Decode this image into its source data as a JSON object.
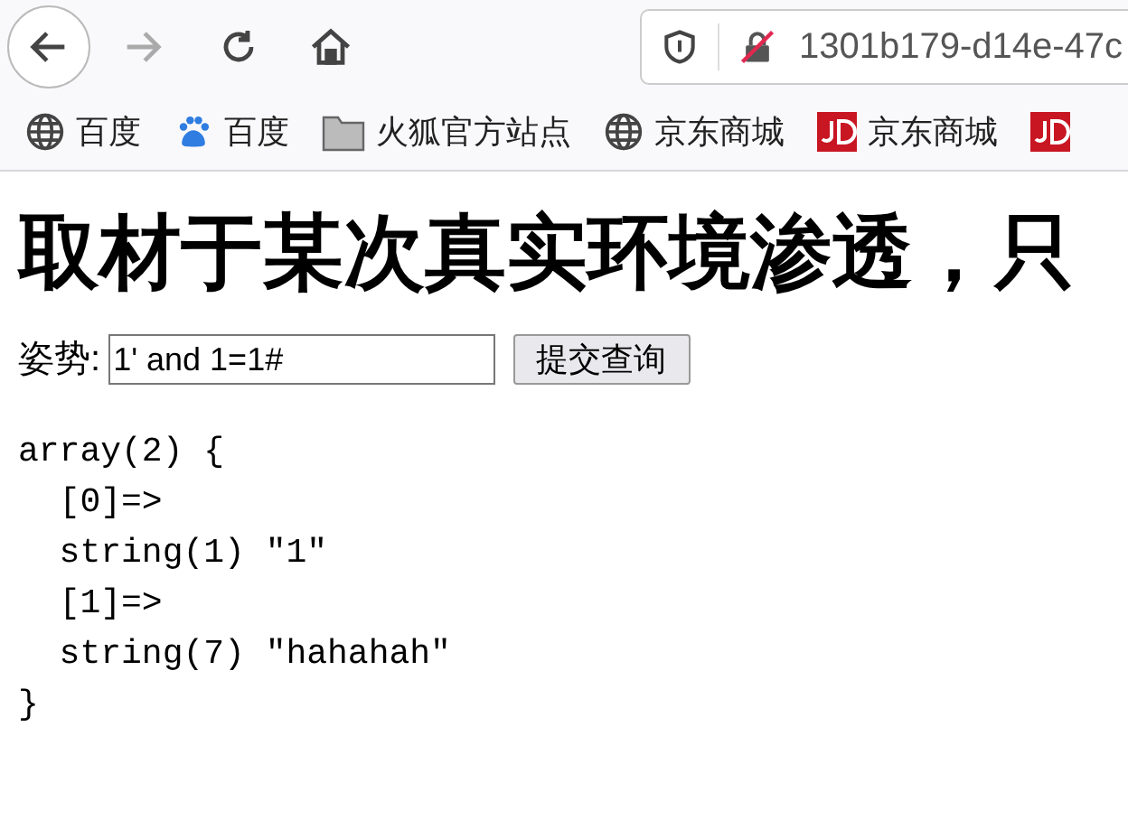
{
  "toolbar": {
    "url": "1301b179-d14e-47c"
  },
  "bookmarks": [
    {
      "kind": "globe",
      "label": "百度"
    },
    {
      "kind": "paw",
      "label": "百度"
    },
    {
      "kind": "folder",
      "label": "火狐官方站点"
    },
    {
      "kind": "globe",
      "label": "京东商城"
    },
    {
      "kind": "jd",
      "label": "京东商城"
    },
    {
      "kind": "jd"
    }
  ],
  "page": {
    "heading": "取材于某次真实环境渗透，只",
    "form": {
      "label": "姿势:",
      "value": "1' and 1=1#",
      "button": "提交查询"
    },
    "output": "array(2) {\n  [0]=>\n  string(1) \"1\"\n  [1]=>\n  string(7) \"hahahah\"\n}"
  }
}
